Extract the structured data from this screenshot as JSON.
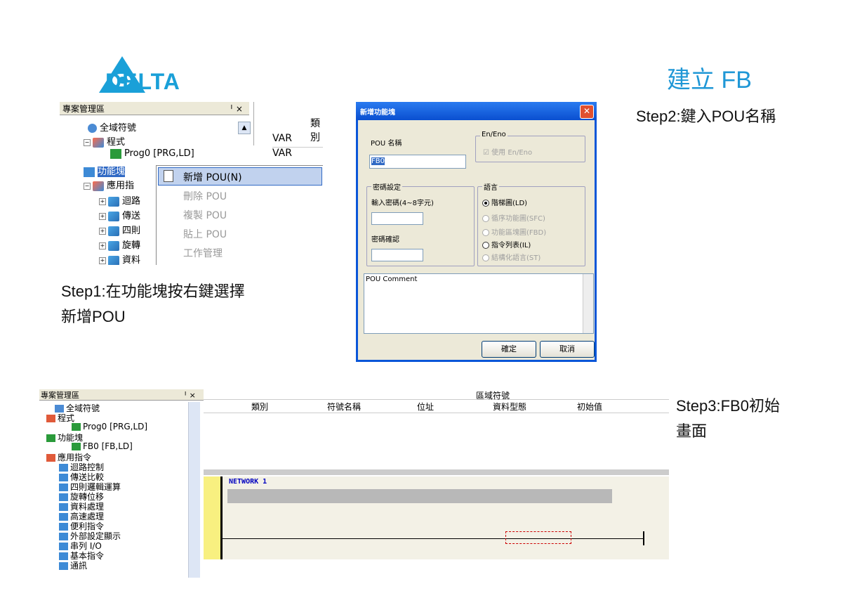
{
  "logo_text": "DELTA",
  "title": "建立 FB",
  "step1_line1": "Step1:在功能塊按右鍵選擇",
  "step1_line2": "新增POU",
  "step2": "Step2:鍵入POU名稱",
  "step3_line1": "Step3:FB0初始",
  "step3_line2": "畫面",
  "panel1": {
    "title": "專案管理區",
    "pin": "ᅵ ×",
    "col_type": "類別",
    "var1": "VAR",
    "var2": "VAR",
    "tree": [
      "全域符號",
      "程式",
      "Prog0 [PRG,LD]",
      "功能塊",
      "應用指",
      "迴路",
      "傳送",
      "四則",
      "旋轉",
      "資料"
    ],
    "menu": [
      "新增 POU(N)",
      "刪除 POU",
      "複製 POU",
      "貼上 POU",
      "工作管理"
    ]
  },
  "dialog": {
    "title": "新增功能塊",
    "pou_name_label": "POU 名稱",
    "pou_name_value": "FB0",
    "enEno_group": "En/Eno",
    "enEno_check": "使用 En/Eno",
    "pwd_group": "密碼設定",
    "pwd_input": "輸入密碼(4~8字元)",
    "pwd_confirm": "密碼確認",
    "lang_group": "語言",
    "lang_options": [
      "階梯圖(LD)",
      "循序功能圖(SFC)",
      "功能區塊圖(FBD)",
      "指令列表(IL)",
      "結構化語言(ST)"
    ],
    "comment": "POU Comment",
    "ok": "確定",
    "cancel": "取消"
  },
  "panel3": {
    "title": "專案管理區",
    "pin": "ᅵ ×",
    "tree": [
      "全域符號",
      "程式",
      "Prog0 [PRG,LD]",
      "功能塊",
      "FB0 [FB,LD]",
      "應用指令",
      "迴路控制",
      "傳送比較",
      "四則邏輯運算",
      "旋轉位移",
      "資料處理",
      "高速處理",
      "便利指令",
      "外部設定顯示",
      "串列 I/O",
      "基本指令",
      "通訊"
    ],
    "header": "區域符號",
    "columns": [
      "類別",
      "符號名稱",
      "位址",
      "資料型態",
      "初始值"
    ],
    "network": "NETWORK 1"
  }
}
